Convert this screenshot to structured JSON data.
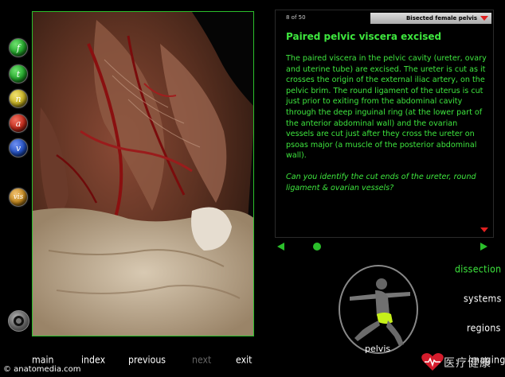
{
  "side_buttons": [
    {
      "label": "f",
      "color": "#22a82a"
    },
    {
      "label": "t",
      "color": "#22a82a"
    },
    {
      "label": "n",
      "color": "#c9b422"
    },
    {
      "label": "a",
      "color": "#c42a1a"
    },
    {
      "label": "v",
      "color": "#2251c4"
    },
    {
      "label": "vis",
      "color": "#c68a1e"
    }
  ],
  "info": {
    "page_count": "8 of 50",
    "section": "Bisected female pelvis",
    "title": "Paired pelvic viscera excised",
    "body": "The paired viscera in the pelvic cavity (ureter, ovary and uterine tube) are excised. The ureter is cut as it crosses the origin of the external iliac artery, on the pelvic brim. The round ligament of the uterus is cut just prior to exiting from the abdominal cavity through the deep inguinal ring (at the lower part of the anterior abdominal wall) and the ovarian vessels are cut just after they cross the ureter on psoas major (a muscle of the posterior abdominal wall).",
    "question": "Can you identify the cut ends of the ureter, round ligament & ovarian vessels?"
  },
  "menu": {
    "dissection": "dissection",
    "systems": "systems",
    "regions": "regions",
    "imaging": "imaging",
    "pelvis": "pelvis"
  },
  "bottom_nav": {
    "main": "main",
    "index": "index",
    "previous": "previous",
    "next": "next",
    "exit": "exit"
  },
  "footer": {
    "site": "© anatomedia.com",
    "logo_text": "医疗健康"
  },
  "colors": {
    "accent": "#3ee63e",
    "border": "#2bbf2b",
    "red": "#e02020"
  }
}
